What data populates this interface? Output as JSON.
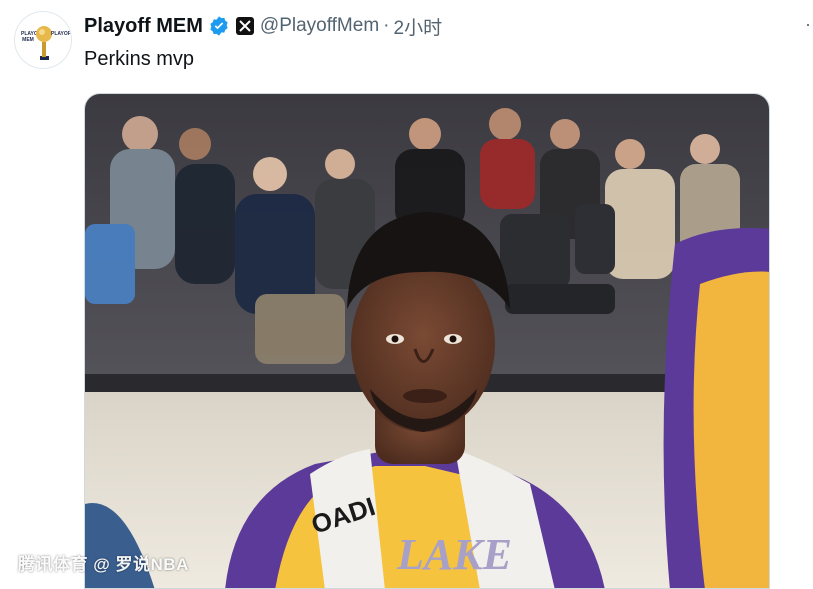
{
  "author": {
    "display_name": "Playoff MEM",
    "handle": "@PlayoffMem",
    "separator": "·",
    "timestamp": "2小时",
    "avatar": {
      "left_text": "PLAYOFF MEM",
      "right_text": "PLAYOFF"
    }
  },
  "tweet": {
    "text": "Perkins mvp"
  },
  "media": {
    "jersey_text": "LAKE",
    "shirt_text": "OADI"
  },
  "watermark": "腾讯体育 @ 罗说NBA",
  "colors": {
    "verified": "#1d9bf0",
    "text_primary": "#0f1419",
    "text_secondary": "#536471",
    "lakers_purple": "#552583",
    "lakers_gold": "#fdb927"
  }
}
